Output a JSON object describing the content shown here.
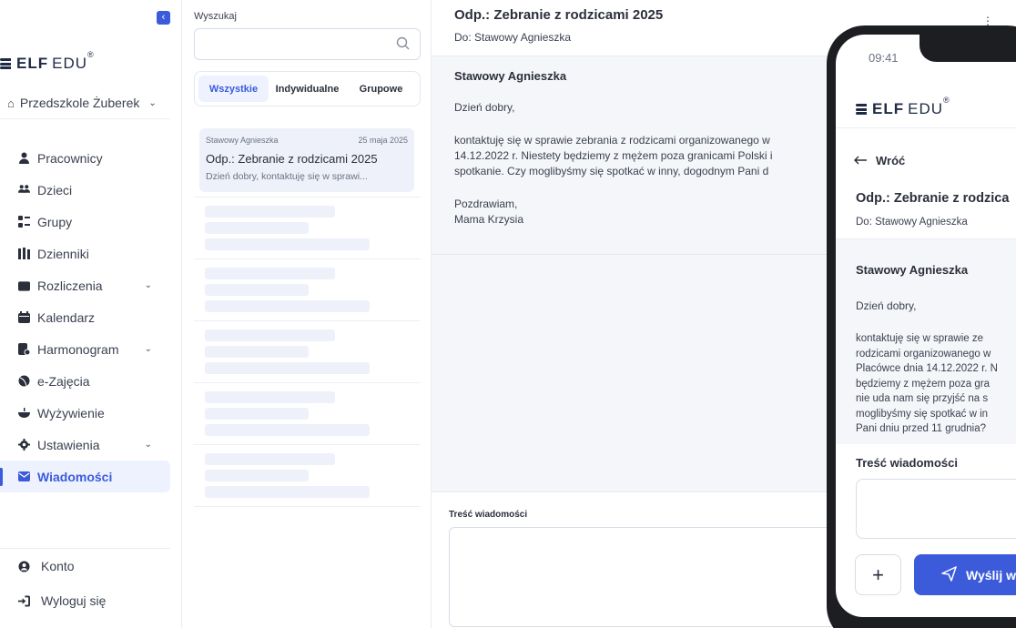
{
  "sidebar": {
    "logo": {
      "elf": "ELF",
      "edu": "EDU",
      "reg": "®"
    },
    "school": "Przedszkole Żuberek",
    "items": [
      {
        "label": "Pracownicy",
        "icon": "person-icon"
      },
      {
        "label": "Dzieci",
        "icon": "children-icon"
      },
      {
        "label": "Grupy",
        "icon": "groups-icon"
      },
      {
        "label": "Dzienniki",
        "icon": "journal-icon"
      },
      {
        "label": "Rozliczenia",
        "icon": "wallet-icon"
      },
      {
        "label": "Kalendarz",
        "icon": "calendar-icon"
      },
      {
        "label": "Harmonogram",
        "icon": "schedule-icon"
      },
      {
        "label": "e-Zajęcia",
        "icon": "ball-icon"
      },
      {
        "label": "Wyżywienie",
        "icon": "bowl-icon"
      },
      {
        "label": "Ustawienia",
        "icon": "gear-icon"
      },
      {
        "label": "Wiadomości",
        "icon": "envelope-icon"
      }
    ],
    "bottom": [
      {
        "label": "Konto",
        "icon": "account-icon"
      },
      {
        "label": "Wyloguj się",
        "icon": "logout-icon"
      }
    ]
  },
  "list": {
    "search_label": "Wyszukaj",
    "search_value": "",
    "tabs": [
      "Wszystkie",
      "Indywidualne",
      "Grupowe"
    ],
    "messages": [
      {
        "sender": "Stawowy Agnieszka",
        "date": "25 maja 2025",
        "subject": "Odp.: Zebranie z rodzicami 2025",
        "preview": "Dzień dobry, kontaktuję się w sprawi..."
      }
    ]
  },
  "main": {
    "title": "Odp.: Zebranie z rodzicami 2025",
    "to": "Do: Stawowy Agnieszka",
    "sender": "Stawowy Agnieszka",
    "greeting": "Dzień dobry,",
    "body": "kontaktuję się w sprawie zebrania z rodzicami organizowanego w\n14.12.2022 r. Niestety będziemy z mężem poza granicami Polski i\nspotkanie. Czy moglibyśmy się spotkać w inny, dogodnym Pani d",
    "signoff": "Pozdrawiam,\nMama Krzysia",
    "compose_label": "Treść wiadomości",
    "compose_value": ""
  },
  "phone": {
    "time": "09:41",
    "back": "Wróć",
    "title": "Odp.: Zebranie z rodzica",
    "to": "Do: Stawowy Agnieszka",
    "sender": "Stawowy Agnieszka",
    "greeting": "Dzień dobry,",
    "body": "kontaktuję się w sprawie ze\nrodzicami organizowanego w\nPlacówce dnia 14.12.2022 r. N\nbędziemy z mężem poza gra\nnie uda nam się przyjść na s\nmoglibyśmy się spotkać w in\nPani dniu przed 11 grudnia?",
    "compose_label": "Treść wiadomości",
    "plus": "+",
    "send_label": "Wyślij w"
  },
  "colors": {
    "accent": "#3b5bdb",
    "active_bg": "#eef2ff",
    "text": "#2a2f3a"
  }
}
